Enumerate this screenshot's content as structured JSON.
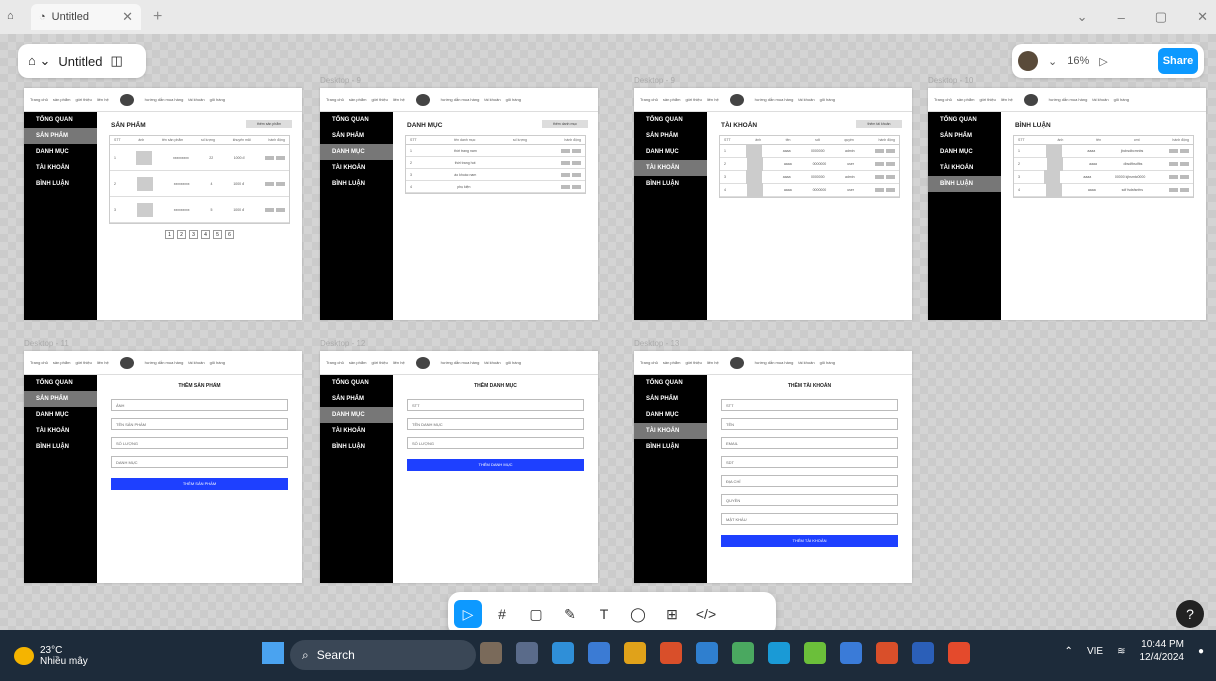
{
  "browser": {
    "tab_title": "Untitled",
    "close_glyph": "✕",
    "new_tab_glyph": "+",
    "controls": [
      "⌄",
      "–",
      "▢",
      "✕"
    ]
  },
  "file": {
    "name": "Untitled",
    "menu_glyph": "⌂ ⌄",
    "panel_glyph": "◫"
  },
  "header": {
    "zoom": "16%",
    "share": "Share",
    "play_glyph": "▷",
    "caret": "⌄"
  },
  "frame_labels": [
    "",
    "Desktop - 9",
    "Desktop - 9",
    "Desktop - 10",
    "Desktop - 11",
    "Desktop - 12",
    "Desktop - 13"
  ],
  "nav": {
    "items": [
      "Trang chủ",
      "sản phẩm",
      "giới thiệu",
      "liên hệ"
    ],
    "right": [
      "hướng dẫn mua hàng",
      "tài khoản",
      "giỏ hàng"
    ]
  },
  "sidebar": {
    "items": [
      "TỔNG QUAN",
      "SẢN PHẨM",
      "DANH MỤC",
      "TÀI KHOẢN",
      "BÌNH LUẬN"
    ]
  },
  "frames": [
    {
      "title": "SẢN PHẨM",
      "add": "thêm sản phẩm",
      "active": 1,
      "cols": [
        "STT",
        "ảnh",
        "tên sản phẩm",
        "số lượng",
        "khuyến mãi",
        "hành động"
      ],
      "rows": [
        [
          "1",
          "",
          "xxxxxxxxx",
          "22",
          "1000 đ"
        ],
        [
          "2",
          "",
          "xxxxxxxxx",
          "4",
          "1000 đ"
        ],
        [
          "3",
          "",
          "xxxxxxxxx",
          "5",
          "1000 đ"
        ]
      ],
      "pages": [
        "1",
        "2",
        "3",
        "4",
        "5",
        "6"
      ]
    },
    {
      "title": "DANH MỤC",
      "add": "thêm danh mục",
      "active": 2,
      "cols": [
        "STT",
        "tên danh mục",
        "số lượng",
        "hành động"
      ],
      "rows": [
        [
          "1",
          "thời trang nam",
          ""
        ],
        [
          "2",
          "thời trang hot",
          ""
        ],
        [
          "3",
          "áo khoác nam",
          ""
        ],
        [
          "4",
          "phụ kiện",
          ""
        ]
      ]
    },
    {
      "title": "TÀI KHOẢN",
      "add": "thêm tài khoản",
      "active": 3,
      "cols": [
        "STT",
        "ảnh",
        "tên",
        "sdt",
        "quyền",
        "hành động"
      ],
      "rows": [
        [
          "1",
          "",
          "aaaa",
          "0000000",
          "admin"
        ],
        [
          "2",
          "",
          "aaaa",
          "0000000",
          "user"
        ],
        [
          "3",
          "",
          "aaaa",
          "0000000",
          "admin"
        ],
        [
          "4",
          "",
          "aaaa",
          "0000000",
          "user"
        ]
      ]
    },
    {
      "title": "BÌNH LUẬN",
      "add": "",
      "active": 4,
      "cols": [
        "STT",
        "ảnh",
        "tên",
        "cmt",
        "hành động"
      ],
      "rows": [
        [
          "1",
          "",
          "aaaa",
          "jbcbsdbcmnbs"
        ],
        [
          "2",
          "",
          "aaaa",
          "dbsdfbsdfbs"
        ],
        [
          "3",
          "",
          "aaaa",
          "00000 kjhsmtc0000"
        ],
        [
          "4",
          "",
          "aaaa",
          "sdf fsdsfsnfns"
        ]
      ]
    }
  ],
  "forms": [
    {
      "title": "THÊM SẢN PHẨM",
      "active": 1,
      "fields": [
        "ẢNH",
        "TÊN SẢN PHẨM",
        "SỐ LƯỢNG",
        "DANH MỤC"
      ],
      "submit": "THÊM SẢN PHẨM"
    },
    {
      "title": "THÊM DANH MỤC",
      "active": 2,
      "fields": [
        "STT",
        "TÊN DANH MỤC",
        "SỐ LƯỢNG"
      ],
      "submit": "THÊM DANH MỤC"
    },
    {
      "title": "THÊM TÀI KHOẢN",
      "active": 3,
      "fields": [
        "STT",
        "TÊN",
        "EMAIL",
        "SDT",
        "ĐỊA CHỈ",
        "QUYỀN",
        "MẬT KHẨU"
      ],
      "submit": "THÊM TÀI KHOẢN"
    }
  ],
  "toolbar": {
    "tools": [
      "move-icon",
      "frame-icon",
      "shape-icon",
      "pen-icon",
      "text-icon",
      "comment-icon",
      "actions-icon",
      "dev-mode-icon"
    ],
    "glyphs": [
      "▷",
      "#",
      "▢",
      "✎",
      "T",
      "◯",
      "⊞",
      "</>"
    ]
  },
  "help": "?",
  "taskbar": {
    "temp": "23°C",
    "weather": "Nhiều mây",
    "search": "Search",
    "lang": "VIE",
    "time": "10:44 PM",
    "date": "12/4/2024",
    "badge": "1"
  },
  "colors": {
    "accent": "#0d99ff",
    "submit": "#1e40ff",
    "sidebar": "#000000",
    "active": "#777777"
  }
}
